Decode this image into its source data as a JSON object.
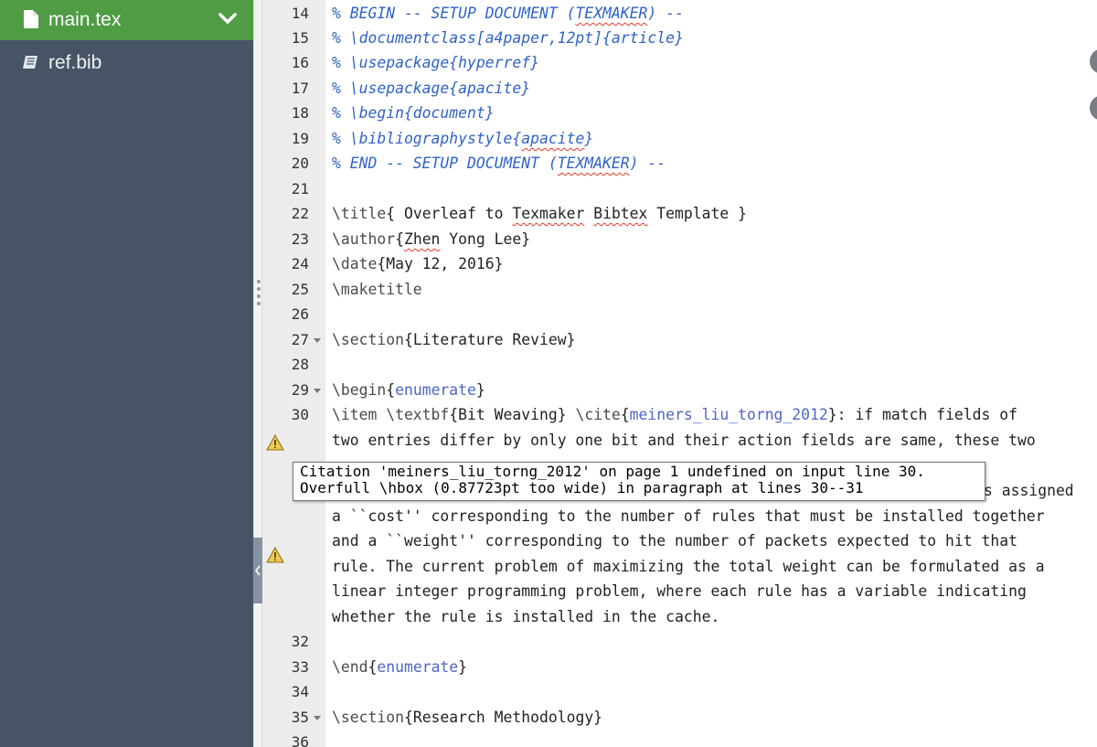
{
  "sidebar": {
    "files": [
      {
        "label": "main.tex",
        "icon": "file-icon",
        "active": true
      },
      {
        "label": "ref.bib",
        "icon": "book-icon",
        "active": false
      }
    ],
    "colors": {
      "background": "#465465",
      "active": "#4f9c45"
    }
  },
  "gutter": {
    "line_numbers": [
      "14",
      "15",
      "16",
      "17",
      "18",
      "19",
      "20",
      "21",
      "22",
      "23",
      "24",
      "25",
      "26",
      "27",
      "28",
      "29",
      "30",
      "32",
      "33",
      "34",
      "35",
      "36"
    ]
  },
  "editor": {
    "lines": {
      "l14": {
        "text": "% BEGIN -- SETUP DOCUMENT (",
        "squig": "TEXMAKER",
        "after": ") --"
      },
      "l15": {
        "text": "% \\documentclass[a4paper,12pt]{article}"
      },
      "l16": {
        "text": "% \\usepackage{hyperref}"
      },
      "l17": {
        "text": "% \\usepackage{apacite}"
      },
      "l18": {
        "text": "% \\begin{document}"
      },
      "l19": {
        "pre": "% \\bibliographystyle{",
        "squig": "apacite",
        "after": "}"
      },
      "l20": {
        "pre": "% END -- SETUP DOCUMENT (",
        "squig": "TEXMAKER",
        "after": ") --"
      },
      "l22": {
        "cmd": "\\title",
        "a1": "{ Overleaf to ",
        "s1": "Texmaker",
        "a2": " ",
        "s2": "Bibtex",
        "a3": " Template }"
      },
      "l23": {
        "cmd": "\\author",
        "a1": "{",
        "s1": "Zhen",
        "a2": " Yong Lee}"
      },
      "l24": {
        "cmd": "\\date",
        "a1": "{May 12, 2016}"
      },
      "l25": {
        "cmd": "\\maketitle"
      },
      "l27": {
        "cmd": "\\section",
        "a1": "{Literature Review}"
      },
      "l29": {
        "cmd": "\\begin",
        "a1": "{",
        "ref": "enumerate",
        "a2": "}"
      },
      "l30": {
        "cmd": "\\item \\textbf",
        "a1": "{Bit Weaving} ",
        "cmd2": "\\cite",
        "a2": "{",
        "ref": "meiners_liu_torng_2012",
        "a3": "}: if match fields of"
      },
      "w1": "two entries differ by only one bit and their action fields are same, these two",
      "w3": "s assigned",
      "w4": "a ``cost'' corresponding to the number of rules that must be installed together",
      "w5": "and a ``weight'' corresponding to the number of packets expected to hit that",
      "w6": "rule. The current problem of maximizing the total weight can be formulated as a",
      "w7": "linear integer programming problem, where each rule has a variable indicating",
      "w8": "whether the rule is installed in the cache.",
      "l33": {
        "cmd": "\\end",
        "a1": "{",
        "ref": "enumerate",
        "a2": "}"
      },
      "l35": {
        "cmd": "\\section",
        "a1": "{Research Methodology}"
      }
    }
  },
  "tooltip": {
    "line1": "Citation 'meiners_liu_torng_2012' on page 1 undefined on input line 30.",
    "line2": "Overfull \\hbox (0.87723pt too wide) in paragraph at lines 30--31"
  }
}
